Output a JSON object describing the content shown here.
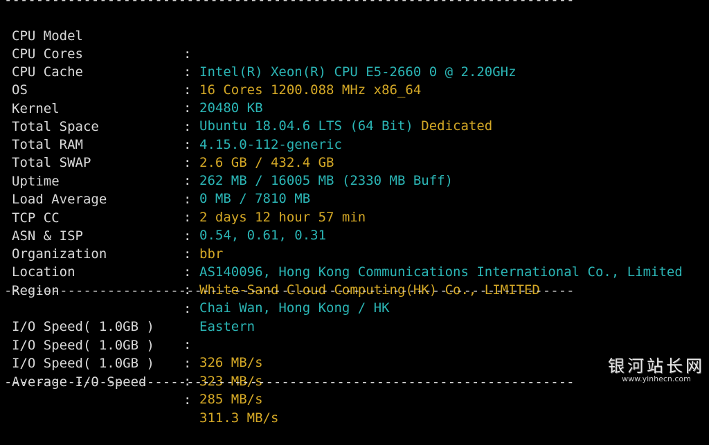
{
  "separator": "------------------------------------------------------------------------",
  "system_info": [
    {
      "label": "CPU Model",
      "value": "Intel(R) Xeon(R) CPU E5-2660 0 @ 2.20GHz",
      "value2": ""
    },
    {
      "label": "CPU Cores",
      "value": "16 Cores 1200.088 MHz x86_64",
      "value2": ""
    },
    {
      "label": "CPU Cache",
      "value": "20480 KB",
      "value2": ""
    },
    {
      "label": "OS",
      "value": "Ubuntu 18.04.6 LTS (64 Bit)",
      "value2": " Dedicated"
    },
    {
      "label": "Kernel",
      "value": "4.15.0-112-generic",
      "value2": ""
    },
    {
      "label": "Total Space",
      "value": "2.6 GB / 432.4 GB",
      "value2": ""
    },
    {
      "label": "Total RAM",
      "value": "262 MB / 16005 MB (2330 MB Buff)",
      "value2": ""
    },
    {
      "label": "Total SWAP",
      "value": "0 MB / 7810 MB",
      "value2": ""
    },
    {
      "label": "Uptime",
      "value": "2 days 12 hour 57 min",
      "value2": ""
    },
    {
      "label": "Load Average",
      "value": "0.54, 0.61, 0.31",
      "value2": ""
    },
    {
      "label": "TCP CC",
      "value": "bbr",
      "value2": ""
    },
    {
      "label": "ASN & ISP",
      "value": "AS140096, Hong Kong Communications International Co., Limited",
      "value2": ""
    },
    {
      "label": "Organization",
      "value": "White-Sand Cloud Computing(HK) Co., LIMITED",
      "value2": ""
    },
    {
      "label": "Location",
      "value": "Chai Wan, Hong Kong / HK",
      "value2": ""
    },
    {
      "label": "Region",
      "value": "Eastern",
      "value2": ""
    }
  ],
  "io_info": [
    {
      "label": "I/O Speed( 1.0GB )",
      "value": "326 MB/s"
    },
    {
      "label": "I/O Speed( 1.0GB )",
      "value": "323 MB/s"
    },
    {
      "label": "I/O Speed( 1.0GB )",
      "value": "285 MB/s"
    },
    {
      "label": "Average I/O Speed",
      "value": "311.3 MB/s"
    }
  ],
  "colon": ":",
  "colors": {
    "background": "#000000",
    "label": "#d9d9d9",
    "cyan": "#2bb5b5",
    "yellow": "#d4a826"
  },
  "watermark": {
    "main": "银河站长网",
    "url": "www.yinhecn.com"
  }
}
